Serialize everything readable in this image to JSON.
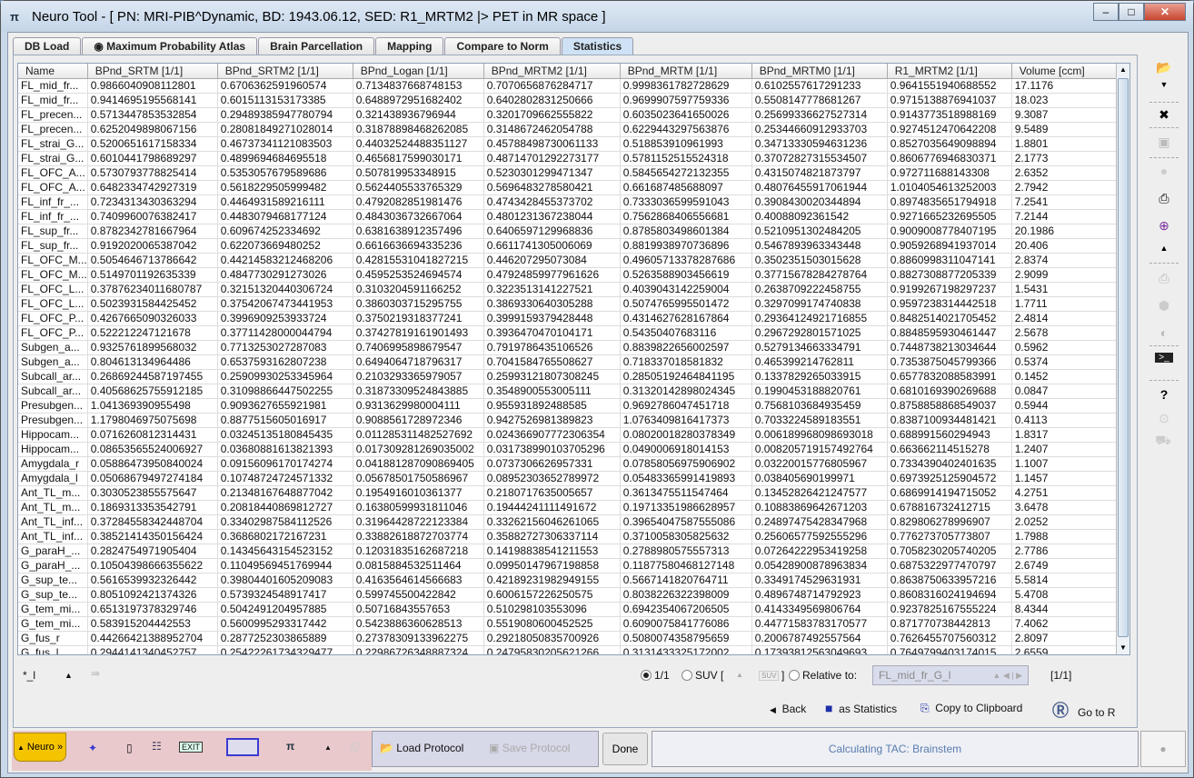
{
  "window": {
    "title": "Neuro Tool - [ PN: MRI-PIB^Dynamic, BD: 1943.06.12, SED: R1_MRTM2 |> PET in MR space ]",
    "app_icon": "pi-icon"
  },
  "tabs": [
    {
      "label": "DB Load"
    },
    {
      "label": "Maximum Probability Atlas"
    },
    {
      "label": "Brain Parcellation"
    },
    {
      "label": "Mapping"
    },
    {
      "label": "Compare to Norm"
    },
    {
      "label": "Statistics",
      "active": true
    }
  ],
  "table": {
    "columns": [
      "Name",
      "BPnd_SRTM [1/1]",
      "BPnd_SRTM2 [1/1]",
      "BPnd_Logan [1/1]",
      "BPnd_MRTM2 [1/1]",
      "BPnd_MRTM [1/1]",
      "BPnd_MRTM0 [1/1]",
      "R1_MRTM2 [1/1]",
      "Volume [ccm]"
    ],
    "rows": [
      [
        "FL_mid_fr...",
        "0.9866040908112801",
        "0.6706362591960574",
        "0.7134837668748153",
        "0.7070656876284717",
        "0.9998361782728629",
        "0.6102557617291233",
        "0.9641551940688552",
        "17.1176"
      ],
      [
        "FL_mid_fr...",
        "0.9414695195568141",
        "0.6015113153173385",
        "0.6488972951682402",
        "0.6402802831250666",
        "0.9699907597759336",
        "0.5508147778681267",
        "0.9715138876941037",
        "18.023"
      ],
      [
        "FL_precen...",
        "0.5713447853532854",
        "0.29489385947780794",
        "0.321438936796944",
        "0.3201709662555822",
        "0.6035023641650026",
        "0.25699336627527314",
        "0.9143773518988169",
        "9.3087"
      ],
      [
        "FL_precen...",
        "0.6252049898067156",
        "0.28081849271028014",
        "0.31878898468262085",
        "0.3148672462054788",
        "0.6229443297563876",
        "0.25344660912933703",
        "0.9274512470642208",
        "9.5489"
      ],
      [
        "FL_strai_G...",
        "0.5200651617158334",
        "0.46737341121083503",
        "0.44032524488351127",
        "0.45788498730061133",
        "0.518853910961993",
        "0.34713330594631236",
        "0.8527035649098894",
        "1.8801"
      ],
      [
        "FL_strai_G...",
        "0.6010441798689297",
        "0.4899694684695518",
        "0.4656817599030171",
        "0.48714701292273177",
        "0.5781152515524318",
        "0.37072827315534507",
        "0.8606776946830371",
        "2.1773"
      ],
      [
        "FL_OFC_A...",
        "0.5730793778825414",
        "0.5353057679589686",
        "0.507819953348915",
        "0.5230301299471347",
        "0.5845654272132355",
        "0.4315074821873797",
        "0.972711688143308",
        "2.6352"
      ],
      [
        "FL_OFC_A...",
        "0.6482334742927319",
        "0.5618229505999482",
        "0.5624405533765329",
        "0.5696483278580421",
        "0.661687485688097",
        "0.48076455917061944",
        "1.0104054613252003",
        "2.7942"
      ],
      [
        "FL_inf_fr_...",
        "0.7234313430363294",
        "0.4464931589216111",
        "0.4792082851981476",
        "0.4743428455373702",
        "0.7333036599591043",
        "0.3908430020344894",
        "0.8974835651794918",
        "7.2541"
      ],
      [
        "FL_inf_fr_...",
        "0.7409960076382417",
        "0.4483079468177124",
        "0.4843036732667064",
        "0.4801231367238044",
        "0.7562868406556681",
        "0.40088092361542",
        "0.9271665232695505",
        "7.2144"
      ],
      [
        "FL_sup_fr...",
        "0.8782342781667964",
        "0.609674252334692",
        "0.6381638912357496",
        "0.6406597129968836",
        "0.8785803498601384",
        "0.5210951302484205",
        "0.9009008778407195",
        "20.1986"
      ],
      [
        "FL_sup_fr...",
        "0.9192020065387042",
        "0.622073669480252",
        "0.6616636694335236",
        "0.6611741305006069",
        "0.8819938970736896",
        "0.5467893963343448",
        "0.9059268941937014",
        "20.406"
      ],
      [
        "FL_OFC_M...",
        "0.5054646713786642",
        "0.44214583212468206",
        "0.42815531041827215",
        "0.446207295073084",
        "0.49605713378287686",
        "0.3502351503015628",
        "0.8860998311047141",
        "2.8374"
      ],
      [
        "FL_OFC_M...",
        "0.5149701192635339",
        "0.4847730291273026",
        "0.4595253524694574",
        "0.47924859977961626",
        "0.5263588903456619",
        "0.37715678284278764",
        "0.8827308877205339",
        "2.9099"
      ],
      [
        "FL_OFC_L...",
        "0.37876234011680787",
        "0.32151320440306724",
        "0.3103204591166252",
        "0.3223513141227521",
        "0.4039043142259004",
        "0.2638709222458755",
        "0.9199267198297237",
        "1.5431"
      ],
      [
        "FL_OFC_L...",
        "0.5023931584425452",
        "0.37542067473441953",
        "0.3860303715295755",
        "0.3869330640305288",
        "0.5074765995501472",
        "0.3297099174740838",
        "0.9597238314442518",
        "1.7711"
      ],
      [
        "FL_OFC_P...",
        "0.4267665090326033",
        "0.3996909253933724",
        "0.3750219318377241",
        "0.3999159379428448",
        "0.4314627628167864",
        "0.29364124921716855",
        "0.8482514021705452",
        "2.4814"
      ],
      [
        "FL_OFC_P...",
        "0.522212247121678",
        "0.37711428000044794",
        "0.37427819161901493",
        "0.3936470470104171",
        "0.54350407683116",
        "0.2967292801571025",
        "0.8848595930461447",
        "2.5678"
      ],
      [
        "Subgen_a...",
        "0.9325761899568032",
        "0.7713253027287083",
        "0.7406995898679547",
        "0.7919786435106526",
        "0.8839822656002597",
        "0.5279134663334791",
        "0.7448738213034644",
        "0.5962"
      ],
      [
        "Subgen_a...",
        "0.804613134964486",
        "0.6537593162807238",
        "0.6494064718796317",
        "0.7041584765508627",
        "0.718337018581832",
        "0.465399214762811",
        "0.7353875045799366",
        "0.5374"
      ],
      [
        "Subcall_ar...",
        "0.26869244587197455",
        "0.25909930253345964",
        "0.2103293365979057",
        "0.25993121807308245",
        "0.28505192464841195",
        "0.1337829265033915",
        "0.6577832088583991",
        "0.1452"
      ],
      [
        "Subcall_ar...",
        "0.40568625755912185",
        "0.31098866447502255",
        "0.31873309524843885",
        "0.3548900553005111",
        "0.31320142898024345",
        "0.1990453188820761",
        "0.6810169390269688",
        "0.0847"
      ],
      [
        "Presubgen...",
        "1.041369390955498",
        "0.9093627655921981",
        "0.9313629980004111",
        "0.955931892488585",
        "0.9692786047451718",
        "0.7568103684935459",
        "0.8758858868549037",
        "0.5944"
      ],
      [
        "Presubgen...",
        "1.1798046975075698",
        "0.8877515605016917",
        "0.9088561728972346",
        "0.9427526981389823",
        "1.0763409816417373",
        "0.7033224589183551",
        "0.8387100934481421",
        "0.4113"
      ],
      [
        "Hippocam...",
        "0.0716260812314431",
        "0.03245135180845435",
        "0.011285311482527692",
        "0.024366907772306354",
        "0.08020018280378349",
        "0.006189968098693018",
        "0.688991560294943",
        "1.8317"
      ],
      [
        "Hippocam...",
        "0.08653565524006927",
        "0.03680881613821393",
        "0.017309281269035002",
        "0.031738990103705296",
        "0.0490006918014153",
        "0.008205719157492764",
        "0.663662114515278",
        "1.2407"
      ],
      [
        "Amygdala_r",
        "0.05886473950840024",
        "0.09156096170174274",
        "0.041881287090869405",
        "0.0737306626957331",
        "0.07858056975906902",
        "0.03220015776805967",
        "0.7334390402401635",
        "1.1007"
      ],
      [
        "Amygdala_l",
        "0.05068679497274184",
        "0.10748724724571332",
        "0.05678501750586967",
        "0.08952303652789972",
        "0.05483365991419893",
        "0.038405690199971",
        "0.6973925125904572",
        "1.1457"
      ],
      [
        "Ant_TL_m...",
        "0.3030523855575647",
        "0.21348167648877042",
        "0.1954916010361377",
        "0.2180717635005657",
        "0.3613475511547464",
        "0.13452826421247577",
        "0.6869914194715052",
        "4.2751"
      ],
      [
        "Ant_TL_m...",
        "0.1869313353542791",
        "0.20818440869812727",
        "0.16380599931811046",
        "0.19444241111491672",
        "0.19713351986628957",
        "0.10883869642671203",
        "0.678816732412715",
        "3.6478"
      ],
      [
        "Ant_TL_inf...",
        "0.37284558342448704",
        "0.33402987584112526",
        "0.31964428722123384",
        "0.33262156046261065",
        "0.39654047587555086",
        "0.24897475428347968",
        "0.829806278996907",
        "2.0252"
      ],
      [
        "Ant_TL_inf...",
        "0.38521414350156424",
        "0.3686802172167231",
        "0.33882618872703774",
        "0.35882727306337114",
        "0.3710058305825632",
        "0.25606577592555296",
        "0.776273705773807",
        "1.7988"
      ],
      [
        "G_paraH_...",
        "0.2824754971905404",
        "0.14345643154523152",
        "0.12031835162687218",
        "0.14198838541211553",
        "0.2788980575557313",
        "0.07264222953419258",
        "0.7058230205740205",
        "2.7786"
      ],
      [
        "G_paraH_...",
        "0.10504398666355622",
        "0.11049569451769944",
        "0.0815884532511464",
        "0.09950147967198858",
        "0.11877580468127148",
        "0.05428900878963834",
        "0.6875322977470797",
        "2.6749"
      ],
      [
        "G_sup_te...",
        "0.5616539932326442",
        "0.39804401605209083",
        "0.4163564614566683",
        "0.42189231982949155",
        "0.5667141820764711",
        "0.3349174529631931",
        "0.8638750633957216",
        "5.5814"
      ],
      [
        "G_sup_te...",
        "0.8051092421374326",
        "0.5739324548917417",
        "0.599745500422842",
        "0.6006157226250575",
        "0.8038226322398009",
        "0.4896748714792923",
        "0.8608316024194694",
        "5.4708"
      ],
      [
        "G_tem_mi...",
        "0.6513197378329746",
        "0.5042491204957885",
        "0.50716843557653",
        "0.510298103553096",
        "0.6942354067206505",
        "0.4143349569806764",
        "0.9237825167555224",
        "8.4344"
      ],
      [
        "G_tem_mi...",
        "0.583915204442553",
        "0.5600995293317442",
        "0.5423886360628513",
        "0.5519080600452525",
        "0.6090075841776086",
        "0.44771583783170577",
        "0.871770738442813",
        "7.4062"
      ],
      [
        "G_fus_r",
        "0.44266421388952704",
        "0.2877252303865889",
        "0.27378309133962275",
        "0.29218050835700926",
        "0.5080074358795659",
        "0.2006787492557564",
        "0.7626455707560312",
        "2.8097"
      ],
      [
        "G_fus_l",
        "0.2944141340452757",
        "0.25422261734329477",
        "0.22986726348887324",
        "0.24795830205621266",
        "0.3131433325172002",
        "0.17393812563049693",
        "0.7649799403174015",
        "2.6559"
      ]
    ]
  },
  "controls": {
    "filter_label": "*_l",
    "ratio_1_1": "1/1",
    "suv_label": "SUV [",
    "suv_close": "]",
    "suv_button": "SUV",
    "relative_label": "Relative to:",
    "relative_value": "FL_mid_fr_G_l",
    "relative_unit": "[1/1]",
    "selected_mode": "1/1"
  },
  "actions": {
    "back": "Back",
    "save_stats": "as Statistics",
    "copy": "Copy to Clipboard",
    "go_r": "Go to R"
  },
  "bottom": {
    "neuro": "Neuro »",
    "load_protocol": "Load Protocol",
    "save_protocol": "Save Protocol",
    "done": "Done",
    "status": "Calculating TAC: Brainstem",
    "exit": "EXIT"
  },
  "colors": {
    "accent_tab": "#cfe2f5",
    "neuro_button": "#f5c400",
    "status_text": "#5a7bb0",
    "bottom_pink": "#e9c9cb"
  }
}
